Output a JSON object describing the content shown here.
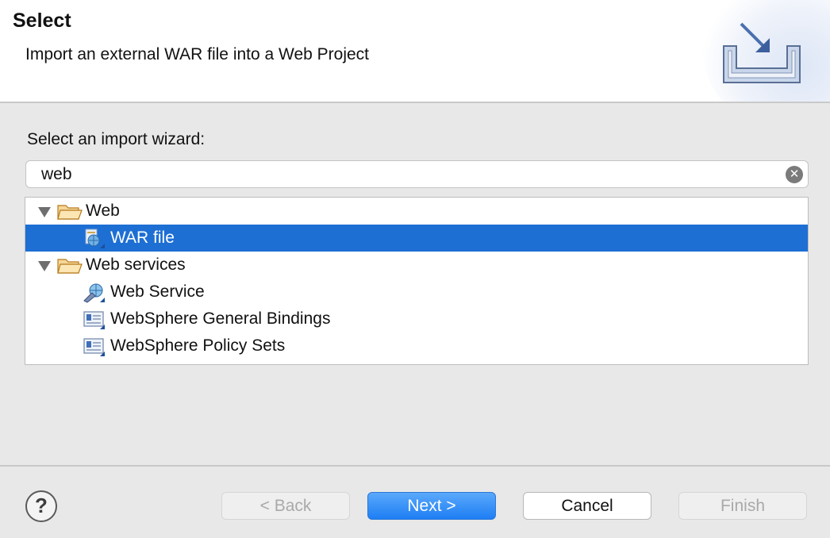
{
  "header": {
    "title": "Select",
    "description": "Import an external WAR file into a Web Project"
  },
  "prompt": "Select an import wizard:",
  "filter": {
    "value": "web",
    "clear_icon": "clear-icon"
  },
  "tree": [
    {
      "label": "Web",
      "type": "folder",
      "expanded": true,
      "icon": "folder-open-icon"
    },
    {
      "label": "WAR file",
      "type": "item",
      "selected": true,
      "icon": "war-file-icon"
    },
    {
      "label": "Web services",
      "type": "folder",
      "expanded": true,
      "icon": "folder-open-icon"
    },
    {
      "label": "Web Service",
      "type": "item",
      "icon": "web-service-icon"
    },
    {
      "label": "WebSphere General Bindings",
      "type": "item",
      "icon": "bindings-icon"
    },
    {
      "label": "WebSphere Policy Sets",
      "type": "item",
      "icon": "policy-sets-icon"
    }
  ],
  "buttons": {
    "help": "?",
    "back": "< Back",
    "next": "Next >",
    "cancel": "Cancel",
    "finish": "Finish"
  },
  "colors": {
    "selection": "#1d6fd4",
    "primary_button": "#1e7ef4",
    "folder": "#e8a33a"
  }
}
